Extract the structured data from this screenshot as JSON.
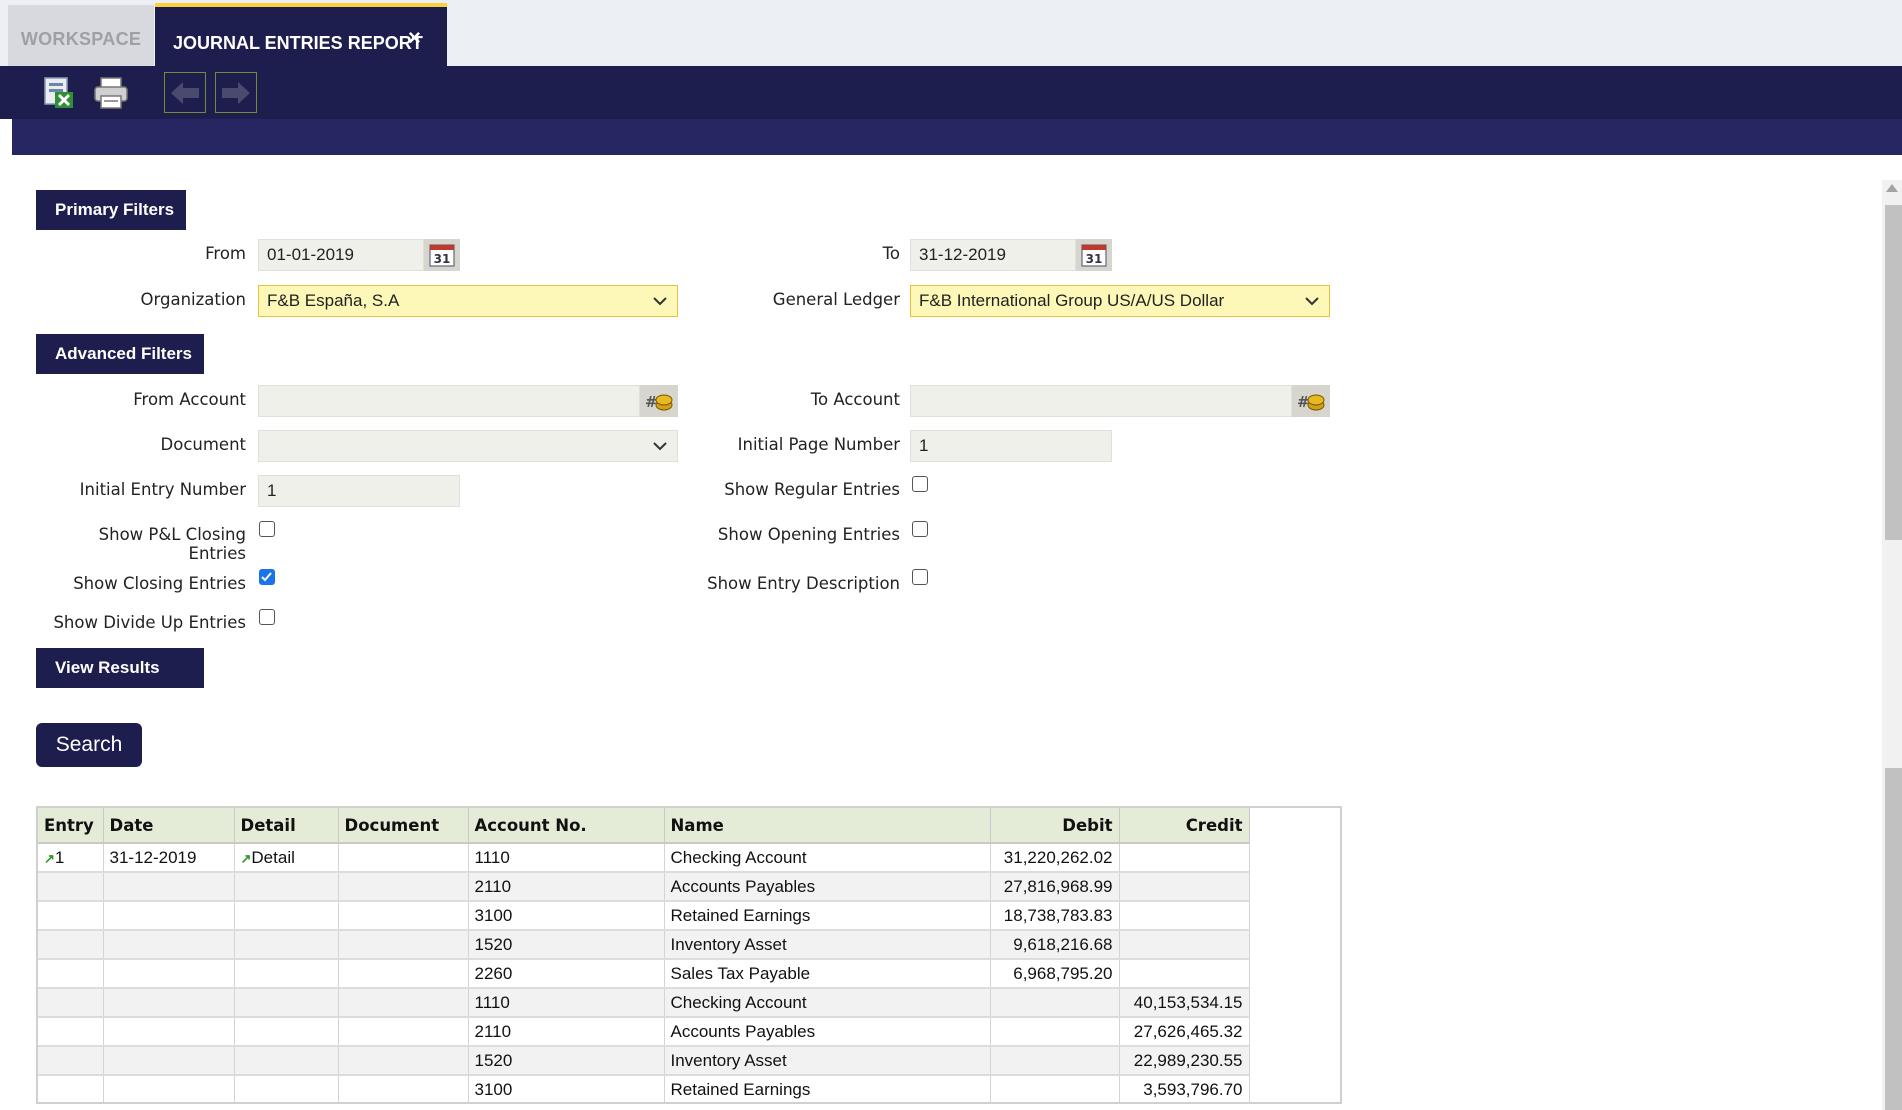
{
  "tabs": {
    "workspace": "WORKSPACE",
    "journal": "JOURNAL ENTRIES REPORT",
    "close": "×"
  },
  "toolbar": {
    "export_icon": "excel-export-icon",
    "print_icon": "print-icon",
    "prev_icon": "previous-arrow-icon",
    "next_icon": "next-arrow-icon"
  },
  "sections": {
    "primary": "Primary Filters",
    "advanced": "Advanced Filters",
    "view": "View Results"
  },
  "filters": {
    "from_label": "From",
    "from_value": "01-01-2019",
    "to_label": "To",
    "to_value": "31-12-2019",
    "calendar_text": "31",
    "org_label": "Organization",
    "org_value": "F&B España, S.A",
    "gl_label": "General Ledger",
    "gl_value": "F&B International Group US/A/US Dollar",
    "from_account_label": "From Account",
    "from_account_value": "",
    "to_account_label": "To Account",
    "to_account_value": "",
    "document_label": "Document",
    "document_value": "",
    "initial_page_label": "Initial Page Number",
    "initial_page_value": "1",
    "initial_entry_label": "Initial Entry Number",
    "initial_entry_value": "1",
    "show_regular_label": "Show Regular Entries",
    "show_regular": false,
    "show_pl_label_1": "Show P&L Closing",
    "show_pl_label_2": "Entries",
    "show_pl": false,
    "show_opening_label": "Show Opening Entries",
    "show_opening": false,
    "show_closing_label": "Show Closing Entries",
    "show_closing": true,
    "show_desc_label": "Show Entry Description",
    "show_desc": false,
    "show_divide_label": "Show Divide Up Entries",
    "show_divide": false
  },
  "search_label": "Search",
  "colors": {
    "navy": "#1e1e4e",
    "tab_accent": "#f8d23b",
    "required_bg": "#fdf8b8",
    "header_bg": "#e4ecd8"
  },
  "table": {
    "headers": [
      "Entry",
      "Date",
      "Detail",
      "Document",
      "Account No.",
      "Name",
      "Debit",
      "Credit"
    ],
    "rows": [
      {
        "entry": "1",
        "date": "31-12-2019",
        "detail": "Detail",
        "document": "",
        "account": "1110",
        "name": "Checking Account",
        "debit": "31,220,262.02",
        "credit": ""
      },
      {
        "entry": "",
        "date": "",
        "detail": "",
        "document": "",
        "account": "2110",
        "name": "Accounts Payables",
        "debit": "27,816,968.99",
        "credit": ""
      },
      {
        "entry": "",
        "date": "",
        "detail": "",
        "document": "",
        "account": "3100",
        "name": "Retained Earnings",
        "debit": "18,738,783.83",
        "credit": ""
      },
      {
        "entry": "",
        "date": "",
        "detail": "",
        "document": "",
        "account": "1520",
        "name": "Inventory Asset",
        "debit": "9,618,216.68",
        "credit": ""
      },
      {
        "entry": "",
        "date": "",
        "detail": "",
        "document": "",
        "account": "2260",
        "name": "Sales Tax Payable",
        "debit": "6,968,795.20",
        "credit": ""
      },
      {
        "entry": "",
        "date": "",
        "detail": "",
        "document": "",
        "account": "1110",
        "name": "Checking Account",
        "debit": "",
        "credit": "40,153,534.15"
      },
      {
        "entry": "",
        "date": "",
        "detail": "",
        "document": "",
        "account": "2110",
        "name": "Accounts Payables",
        "debit": "",
        "credit": "27,626,465.32"
      },
      {
        "entry": "",
        "date": "",
        "detail": "",
        "document": "",
        "account": "1520",
        "name": "Inventory Asset",
        "debit": "",
        "credit": "22,989,230.55"
      },
      {
        "entry": "",
        "date": "",
        "detail": "",
        "document": "",
        "account": "3100",
        "name": "Retained Earnings",
        "debit": "",
        "credit": "3,593,796.70"
      }
    ]
  }
}
